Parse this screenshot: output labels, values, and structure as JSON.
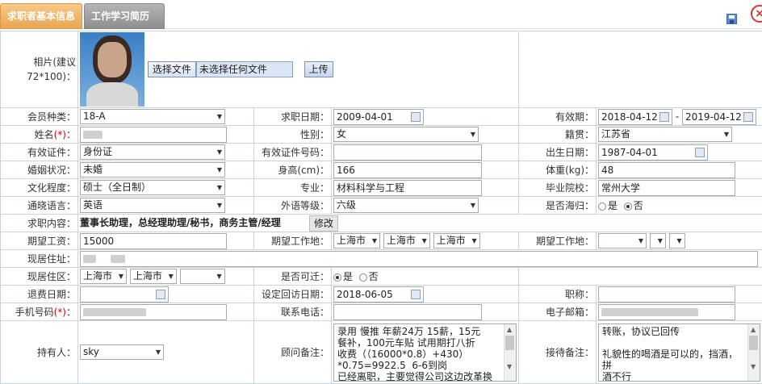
{
  "tabs": [
    "求职者基本信息",
    "工作学习简历"
  ],
  "photo": {
    "label": "相片(建议72*100)：",
    "choose_btn": "选择文件",
    "file_status": "未选择任何文件",
    "upload_btn": "上传"
  },
  "row_member": {
    "member_label": "会员种类：",
    "member_value": "18-A",
    "apply_date_label": "求职日期：",
    "apply_date": "2009-04-01",
    "valid_label": "有效期：",
    "valid_from": "2018-04-12",
    "valid_sep": "-",
    "valid_to": "2019-04-12"
  },
  "row_name": {
    "name_label": "姓名",
    "req": "(*)",
    "colon": "：",
    "gender_label": "性别：",
    "gender": "女",
    "native_label": "籍贯：",
    "native": "江苏省"
  },
  "row_id": {
    "id_label": "有效证件：",
    "id_type": "身份证",
    "id_no_label": "有效证件号码：",
    "id_no": "",
    "birth_label": "出生日期：",
    "birth": "1987-04-01"
  },
  "row_marry": {
    "marry_label": "婚姻状况：",
    "marry": "未婚",
    "height_label": "身高(cm)：",
    "height": "166",
    "weight_label": "体重(kg)：",
    "weight": "48"
  },
  "row_edu": {
    "edu_label": "文化程度：",
    "edu": "硕士（全日制）",
    "major_label": "专业：",
    "major": "材料科学与工程",
    "school_label": "毕业院校：",
    "school": "常州大学"
  },
  "row_lang": {
    "lang_label": "通晓语言：",
    "lang": "英语",
    "level_label": "外语等级：",
    "level": "六级",
    "overseas_label": "是否海归：",
    "yes": "是",
    "no": "否"
  },
  "row_job": {
    "job_label": "求职内容：",
    "job": "董事长助理，总经理助理/秘书，商务主管/经理",
    "edit_btn": "修改"
  },
  "row_salary": {
    "salary_label": "期望工资：",
    "salary": "15000",
    "work_loc_label": "期望工作地：",
    "loc1": "上海市",
    "loc2": "上海市",
    "loc3": "上海市",
    "work_loc2_label": "期望工作地："
  },
  "row_addr": {
    "addr_label": "现居住址："
  },
  "row_area": {
    "area_label": "现居住区：",
    "area1": "上海市",
    "area2": "上海市",
    "move_label": "是否可迁：",
    "yes": "是",
    "no": "否"
  },
  "row_refund": {
    "refund_label": "退费日期：",
    "visit_label": "设定回访日期：",
    "visit": "2018-06-05",
    "title_label": "职称："
  },
  "row_phone": {
    "phone_label": "手机号码",
    "req": "(*)",
    "colon": "：",
    "tel_label": "联系电话：",
    "email_label": "电子邮箱："
  },
  "row_notes": {
    "owner_label": "持有人：",
    "owner": "sky",
    "advisor_label": "顾问备注：",
    "advisor_note": "录用 慢推 年薪24万 15薪，15元\n餐补，100元车贴 试用期打八折\n收费（（16000*0.8）+430）\n*0.75=9922.5  6-6到岗\n已经离职，主要觉得公司这边改革换",
    "reception_label": "接待备注：",
    "reception_note": "转账，协议已回传\n\n礼貌性的喝酒是可以的，挡酒，拼\n酒不行\n倾向于对外商务和项目管理"
  }
}
